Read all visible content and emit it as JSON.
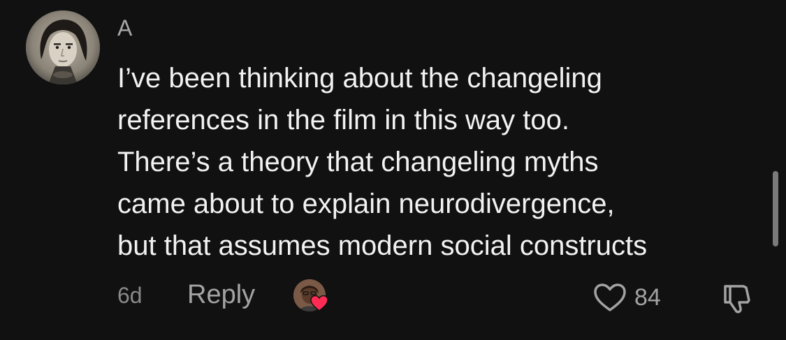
{
  "comment": {
    "username": "A",
    "text_lines": [
      "I’ve been thinking about the changeling",
      "references in the film in this way too.",
      "There’s a theory that changeling myths",
      "came about to explain neurodivergence,",
      "but that assumes modern social constructs"
    ],
    "timestamp": "6d",
    "reply_label": "Reply",
    "like_count": "84",
    "icons": {
      "like": "heart-outline-icon",
      "dislike": "thumbs-down-icon",
      "creator_liked": "heart-filled-icon"
    },
    "colors": {
      "background": "#111111",
      "text": "#f2f2f2",
      "muted": "#a3a3a3",
      "heart": "#fe2c55"
    }
  }
}
